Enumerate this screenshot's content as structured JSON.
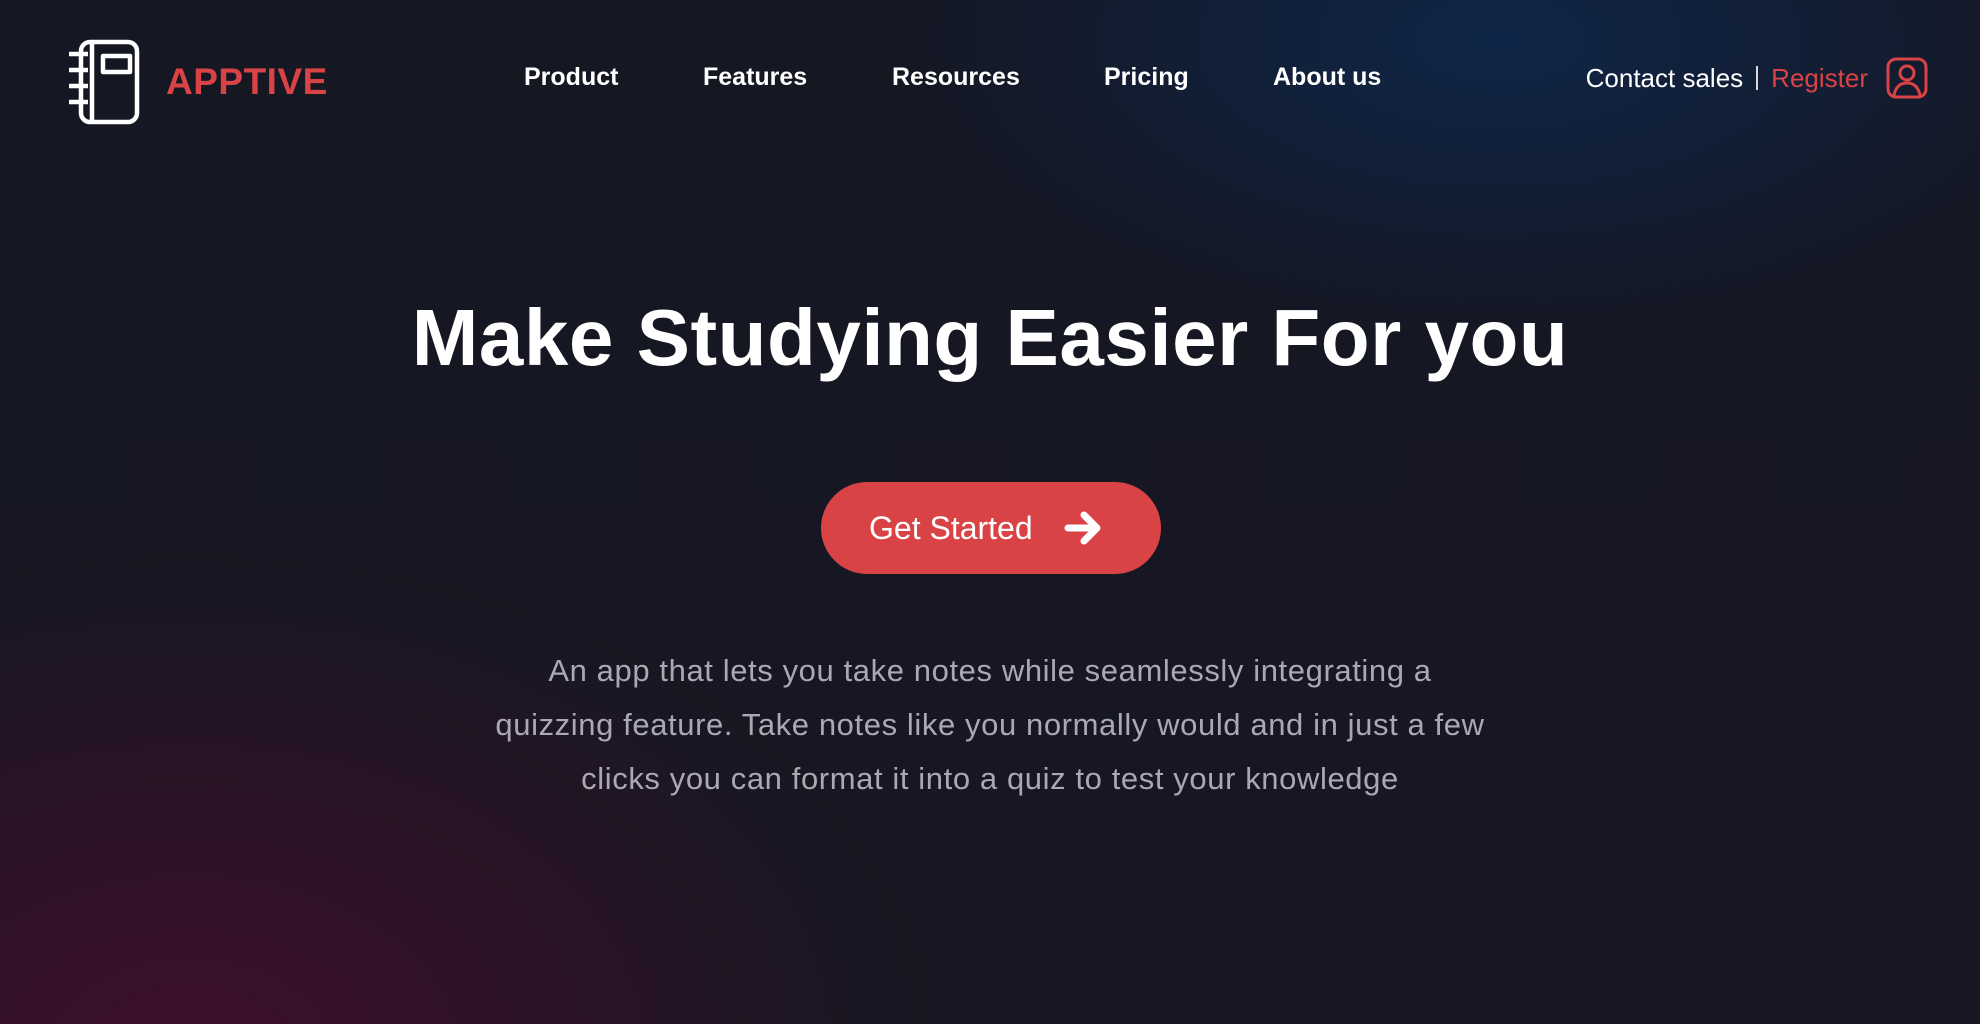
{
  "brand": {
    "name": "APPTIVE",
    "logo_icon": "notebook-icon",
    "accent_color": "#d94346"
  },
  "nav": {
    "items": [
      {
        "label": "Product"
      },
      {
        "label": "Features"
      },
      {
        "label": "Resources"
      },
      {
        "label": "Pricing"
      },
      {
        "label": "About us"
      }
    ]
  },
  "account": {
    "contact_label": "Contact sales",
    "register_label": "Register",
    "user_icon": "user-icon"
  },
  "hero": {
    "title": "Make Studying Easier For you",
    "cta_label": "Get Started",
    "cta_icon": "arrow-right-icon",
    "description": "An app that lets you take notes while seamlessly integrating a quizzing feature. Take notes like you normally would and in just a few clicks you can format it into a quiz to test your knowledge"
  },
  "colors": {
    "background": "#15161f",
    "accent": "#d94346",
    "text_primary": "#ffffff",
    "text_muted": "#a9a8b3"
  }
}
